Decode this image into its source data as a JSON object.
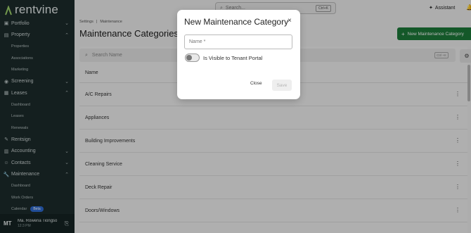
{
  "app": {
    "logo_text": "rentvine"
  },
  "sidebar": {
    "items": [
      {
        "label": "Portfolio",
        "icon": "briefcase-icon",
        "chevron": "⌄"
      },
      {
        "label": "Property",
        "icon": "building-icon",
        "chevron": "⌃",
        "children": [
          "Properties",
          "Associations",
          "Marketing"
        ]
      },
      {
        "label": "Screening",
        "icon": "screening-icon",
        "chevron": "⌄"
      },
      {
        "label": "Leases",
        "icon": "lease-icon",
        "chevron": "⌃",
        "children": [
          "Dashboard",
          "Leases",
          "Renewals"
        ]
      },
      {
        "label": "Rentsign",
        "icon": "sign-icon"
      },
      {
        "label": "Accounting",
        "icon": "accounting-icon",
        "chevron": "⌄"
      },
      {
        "label": "Contacts",
        "icon": "contacts-icon",
        "chevron": "⌄"
      },
      {
        "label": "Maintenance",
        "icon": "wrench-icon",
        "chevron": "⌃",
        "children": [
          "Dashboard",
          "Work Orders",
          "Calendar"
        ]
      }
    ],
    "calendar_badge": "Beta"
  },
  "user": {
    "initials": "MT",
    "name": "Ma. Rowena Tiongso",
    "time": "12:3 PM"
  },
  "topbar": {
    "search_placeholder": "Search...",
    "search_shortcut": "Ctrl+K",
    "assistant_label": "Assistant"
  },
  "breadcrumb": {
    "parent": "Settings",
    "separator": "|",
    "current": "Maintenance"
  },
  "page": {
    "title": "Maintenance Categories",
    "new_button_label": "New Maintenance Category"
  },
  "list": {
    "search_placeholder": "Search Name",
    "search_shortcut": "Ctrl +K",
    "column_header": "Name",
    "rows": [
      "A/C Repairs",
      "Appliances",
      "Building Improvements",
      "Cleaning Service",
      "Deck Repair",
      "Doors/Windows"
    ]
  },
  "modal": {
    "title": "New Maintenance Category",
    "close_icon": "×",
    "name_placeholder": "Name *",
    "toggle_label": "Is Visible to Tenant Portal",
    "toggle_on": false,
    "close_label": "Close",
    "save_label": "Save"
  },
  "colors": {
    "sidebar_bg": "#1c2b2b",
    "primary_green": "#1d7a3a",
    "beta_badge": "#2e6bd1"
  }
}
